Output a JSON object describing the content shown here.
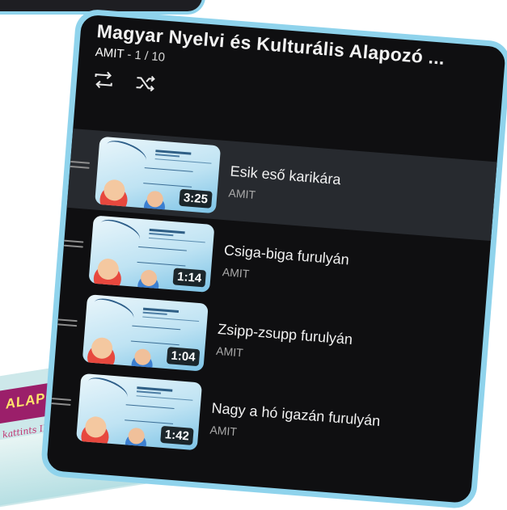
{
  "playlist": {
    "title": "Magyar Nyelvi és Kulturális Alapozó ...",
    "channel": "AMIT",
    "position": " - 1 / 10",
    "controls": [
      {
        "name": "loop-icon"
      },
      {
        "name": "shuffle-icon"
      }
    ]
  },
  "videos": [
    {
      "title": "Esik eső karikára",
      "channel": "AMIT",
      "duration": "3:25",
      "active": true,
      "thumb_header": "ESIK ESŐ KARIKÁRA",
      "thumb_notes": "D E F G A"
    },
    {
      "title": "Csiga-biga furulyán",
      "channel": "AMIT",
      "duration": "1:14",
      "active": false,
      "thumb_header": "CSIGA-BIGA",
      "thumb_notes": "A C"
    },
    {
      "title": "Zsipp-zsupp furulyán",
      "channel": "AMIT",
      "duration": "1:04",
      "active": false,
      "thumb_header": "ZSIPP-ZSUPP",
      "thumb_notes": "E G"
    },
    {
      "title": "Nagy a hó igazán furulyán",
      "channel": "AMIT",
      "duration": "1:42",
      "active": false,
      "thumb_header": "NAGY A HÓ IGAZÁN",
      "thumb_notes": "D F G A"
    }
  ],
  "thumb_script": "Könnyen furulyán",
  "poster": {
    "title": "S ALAPOZÓ PROGRAM",
    "subtitle": "kattints IDE!"
  },
  "colors": {
    "panel_bg": "#0f0f11",
    "frame": "#8fd3ec",
    "active_row": "#272a2f",
    "poster_band": "#9b1f6a",
    "poster_text": "#ffe36b"
  }
}
